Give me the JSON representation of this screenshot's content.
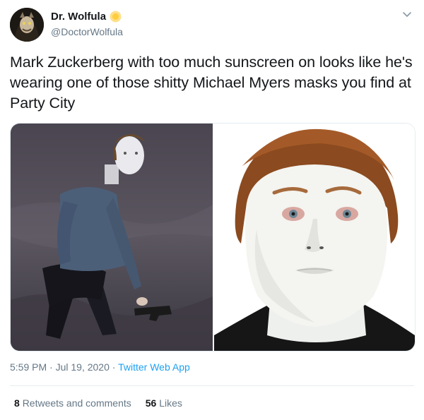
{
  "author": {
    "display_name": "Dr. Wolfula",
    "handle": "@DoctorWolfula",
    "avatar_icon": "wolf-avatar-icon",
    "badge_icon": "sun-emoji-icon"
  },
  "tweet": {
    "text": "Mark Zuckerberg with too much sunscreen on looks like he's wearing one of those shitty Michael Myers masks you find at Party City"
  },
  "media": {
    "images": [
      "person-on-rocks-photo",
      "michael-myers-mask-photo"
    ]
  },
  "meta": {
    "time": "5:59 PM",
    "separator1": " · ",
    "date": "Jul 19, 2020",
    "separator2": " · ",
    "source": "Twitter Web App"
  },
  "stats": {
    "retweets_count": "8",
    "retweets_label": "Retweets and comments",
    "likes_count": "56",
    "likes_label": "Likes"
  },
  "colors": {
    "link": "#1da1f2",
    "muted": "#657786",
    "text": "#14171a",
    "border": "#e6ecf0"
  }
}
